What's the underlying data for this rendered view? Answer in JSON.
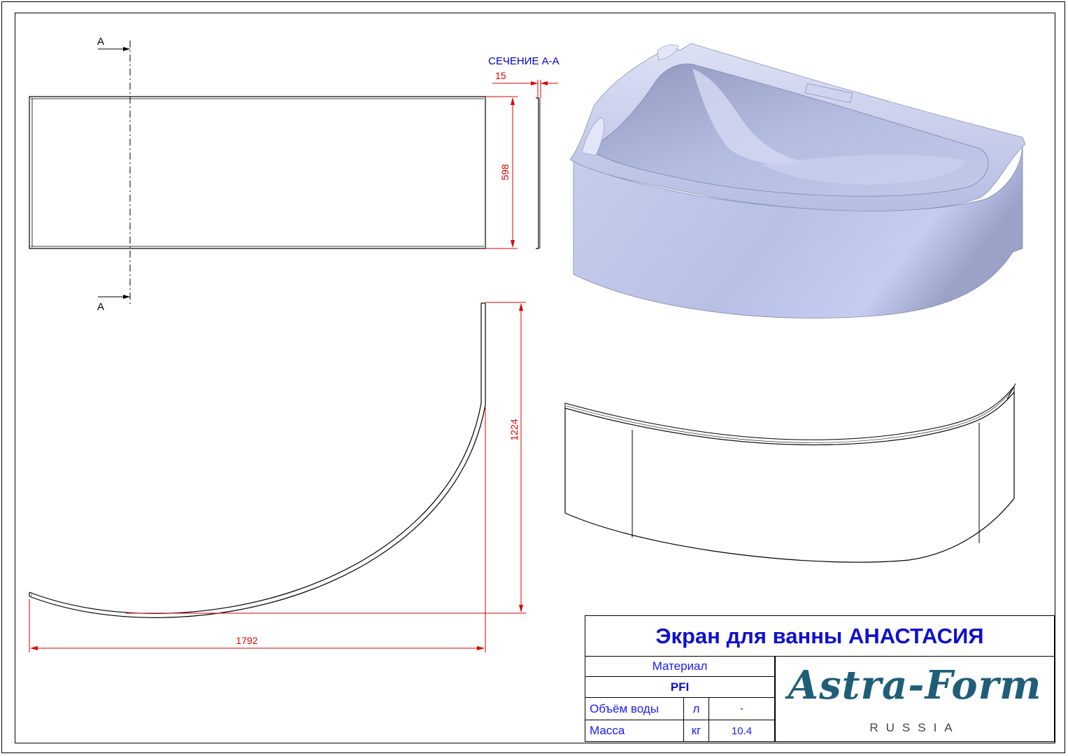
{
  "section_title": "СЕЧЕНИЕ А-А",
  "section_marks": [
    "A",
    "A"
  ],
  "dimensions": {
    "thickness": "15",
    "front_height": "598",
    "depth": "1224",
    "length": "1792"
  },
  "title_block": {
    "title": "Экран для ванны АНАСТАСИЯ",
    "material_label": "Материал",
    "material_value": "PFI",
    "volume_label": "Объём воды",
    "volume_unit": "л",
    "volume_value": "-",
    "mass_label": "Масса",
    "mass_unit": "кг",
    "mass_value": "10.4"
  },
  "brand": {
    "logo_text": "Astra-Form",
    "tagline": "RUSSIA",
    "color": "#1f5e78"
  },
  "colors": {
    "dimension": "#e00000",
    "label": "#0000cc",
    "tub_fill": "#b4bde4"
  }
}
